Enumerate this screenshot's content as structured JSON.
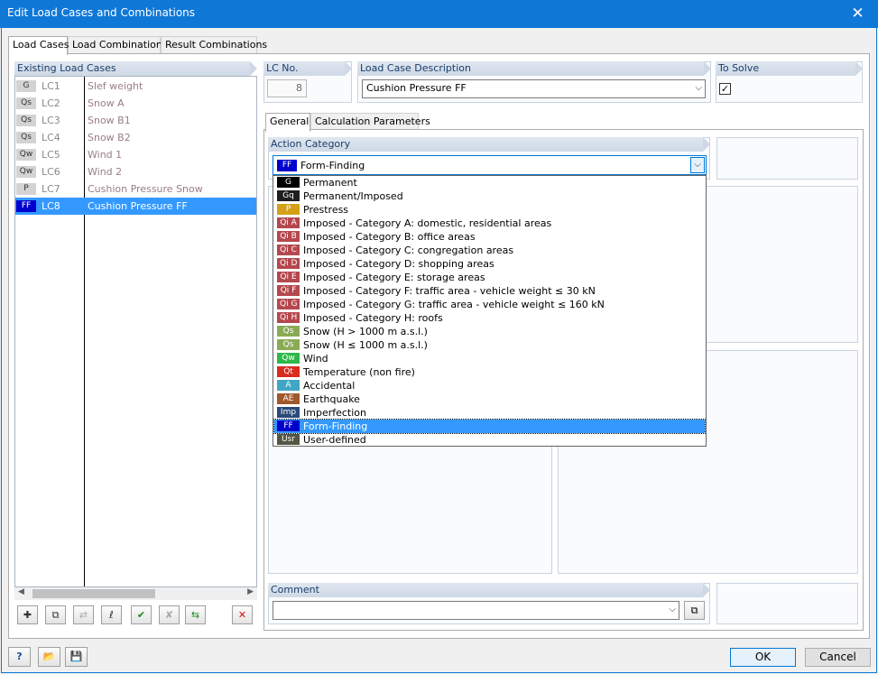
{
  "window": {
    "title": "Edit Load Cases and Combinations",
    "close_glyph": "✕"
  },
  "main_tabs": [
    "Load Cases",
    "Load Combinations",
    "Result Combinations"
  ],
  "existing_load_cases": {
    "header": "Existing Load Cases",
    "rows": [
      {
        "badge": "G",
        "code": "LC1",
        "desc": "Slef weight",
        "selected": false
      },
      {
        "badge": "Qs",
        "code": "LC2",
        "desc": "Snow A",
        "selected": false
      },
      {
        "badge": "Qs",
        "code": "LC3",
        "desc": "Snow B1",
        "selected": false
      },
      {
        "badge": "Qs",
        "code": "LC4",
        "desc": "Snow B2",
        "selected": false
      },
      {
        "badge": "Qw",
        "code": "LC5",
        "desc": "Wind 1",
        "selected": false
      },
      {
        "badge": "Qw",
        "code": "LC6",
        "desc": "Wind 2",
        "selected": false
      },
      {
        "badge": "P",
        "code": "LC7",
        "desc": "Cushion Pressure Snow",
        "selected": false
      },
      {
        "badge": "FF",
        "code": "LC8",
        "desc": "Cushion Pressure FF",
        "selected": true
      }
    ]
  },
  "lc_no": {
    "label": "LC No.",
    "value": "8"
  },
  "description": {
    "label": "Load Case Description",
    "value": "Cushion Pressure FF"
  },
  "to_solve": {
    "label": "To Solve",
    "checked": true,
    "glyph": "✓"
  },
  "inner_tabs": [
    "General",
    "Calculation Parameters"
  ],
  "action_category": {
    "label": "Action Category",
    "selected_badge": "FF",
    "selected_label": "Form-Finding",
    "options": [
      {
        "badge": "G",
        "label": "Permanent",
        "color": "#000000"
      },
      {
        "badge": "Gq",
        "label": "Permanent/Imposed",
        "color": "#1e1e1e"
      },
      {
        "badge": "P",
        "label": "Prestress",
        "color": "#d4a017"
      },
      {
        "badge": "Qi A",
        "label": "Imposed - Category A: domestic, residential areas",
        "color": "#b5474e"
      },
      {
        "badge": "Qi B",
        "label": "Imposed - Category B: office areas",
        "color": "#b5474e"
      },
      {
        "badge": "Qi C",
        "label": "Imposed - Category C: congregation areas",
        "color": "#b5474e"
      },
      {
        "badge": "Qi D",
        "label": "Imposed - Category D: shopping areas",
        "color": "#b5474e"
      },
      {
        "badge": "Qi E",
        "label": "Imposed - Category E: storage areas",
        "color": "#b5474e"
      },
      {
        "badge": "Qi F",
        "label": "Imposed - Category F: traffic area - vehicle weight ≤ 30 kN",
        "color": "#b5474e"
      },
      {
        "badge": "Qi G",
        "label": "Imposed - Category G: traffic area - vehicle weight ≤ 160 kN",
        "color": "#b5474e"
      },
      {
        "badge": "Qi H",
        "label": "Imposed - Category H: roofs",
        "color": "#b5474e"
      },
      {
        "badge": "Qs",
        "label": "Snow (H > 1000 m a.s.l.)",
        "color": "#8aab55"
      },
      {
        "badge": "Qs",
        "label": "Snow (H ≤ 1000 m a.s.l.)",
        "color": "#8aab55"
      },
      {
        "badge": "Qw",
        "label": "Wind",
        "color": "#2eb84a"
      },
      {
        "badge": "Qt",
        "label": "Temperature (non fire)",
        "color": "#d92b1e"
      },
      {
        "badge": "A",
        "label": "Accidental",
        "color": "#3fa7c4"
      },
      {
        "badge": "AE",
        "label": "Earthquake",
        "color": "#a0582a"
      },
      {
        "badge": "Imp",
        "label": "Imperfection",
        "color": "#2a4a7a"
      },
      {
        "badge": "FF",
        "label": "Form-Finding",
        "color": "#0000cc",
        "selected": true
      },
      {
        "badge": "Usr",
        "label": "User-defined",
        "color": "#555544"
      }
    ]
  },
  "comment": {
    "label": "Comment",
    "value": ""
  },
  "buttons": {
    "ok": "OK",
    "cancel": "Cancel"
  },
  "icons": {
    "tool1": "✚",
    "tool2": "⧉",
    "tool3": "⇄",
    "tool4": "ℓ",
    "tool5": "✔",
    "tool6": "✘",
    "tool7": "⇆",
    "delete": "✕",
    "help": "?",
    "open": "📂",
    "save": "💾",
    "comment_btn": "⧉"
  }
}
